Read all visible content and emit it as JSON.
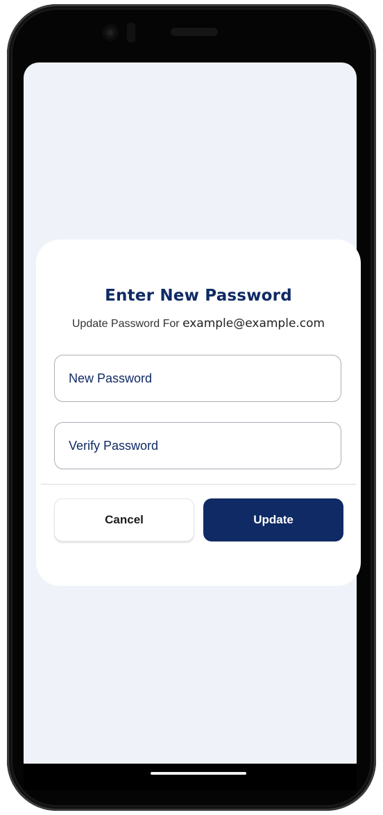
{
  "dialog": {
    "title": "Enter New Password",
    "subtitle_prefix": "Update Password For ",
    "email": "example@example.com",
    "new_password_placeholder": "New Password",
    "verify_password_placeholder": "Verify Password",
    "cancel_label": "Cancel",
    "update_label": "Update"
  },
  "colors": {
    "primary": "#0f2a64",
    "screen_background": "#eff3f9",
    "dialog_background": "#ffffff"
  }
}
